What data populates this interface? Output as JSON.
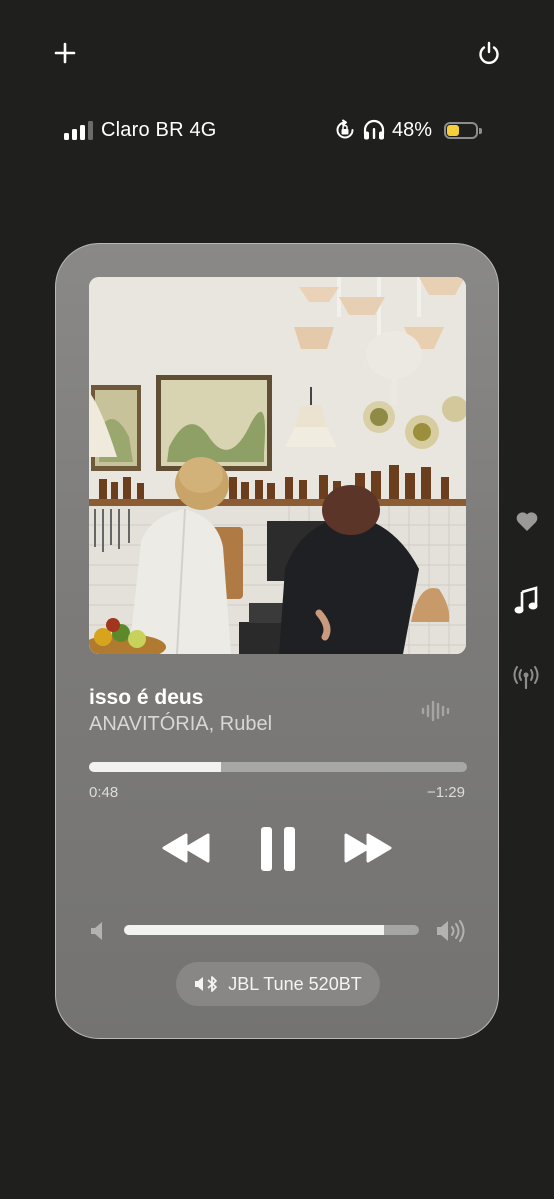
{
  "status_bar": {
    "carrier": "Claro BR 4G",
    "battery_percent": "48%",
    "battery_level": 0.48,
    "battery_color": "#f5cf3b"
  },
  "top_icons": [
    "plus-icon",
    "power-icon"
  ],
  "player": {
    "album_art_icon": "album-art",
    "title": "isso é deus",
    "artist": "ANAVITÓRIA, Rubel",
    "elapsed": "0:48",
    "remaining": "−1:29",
    "progress": 0.35,
    "volume": 0.88,
    "controls": [
      "rewind-icon",
      "pause-icon",
      "fast-forward-icon"
    ],
    "output_device": "JBL Tune 520BT"
  },
  "side_icons": [
    "heart-icon",
    "music-note-icon",
    "antenna-icon"
  ]
}
